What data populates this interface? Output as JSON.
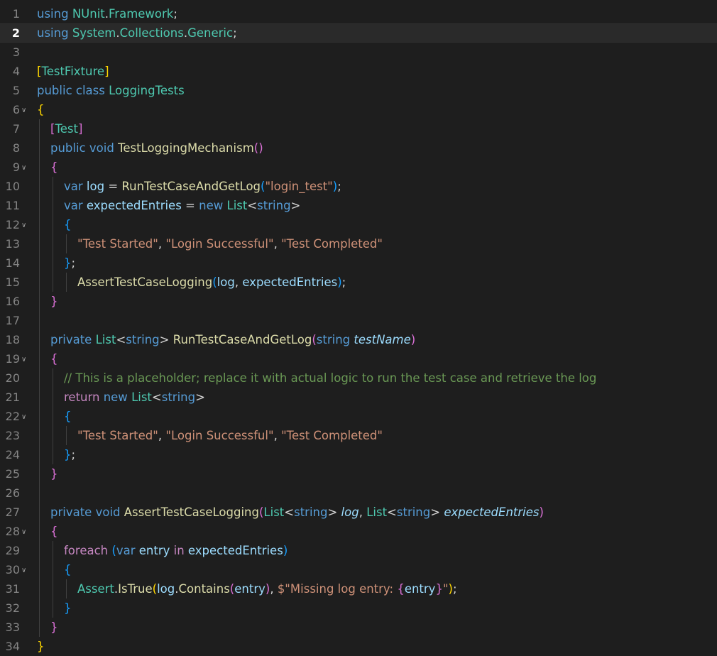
{
  "editor": {
    "current_line": 2,
    "lines": [
      {
        "n": "1",
        "fold": false,
        "indent": 0,
        "tokens": [
          [
            "kw",
            "using"
          ],
          [
            "pu",
            " "
          ],
          [
            "ty",
            "NUnit"
          ],
          [
            "pu",
            "."
          ],
          [
            "ty",
            "Framework"
          ],
          [
            "pu",
            ";"
          ]
        ]
      },
      {
        "n": "2",
        "fold": false,
        "indent": 0,
        "tokens": [
          [
            "kw",
            "using"
          ],
          [
            "pu",
            " "
          ],
          [
            "ty",
            "System"
          ],
          [
            "pu",
            "."
          ],
          [
            "ty",
            "Collections"
          ],
          [
            "pu",
            "."
          ],
          [
            "ty",
            "Generic"
          ],
          [
            "pu",
            ";"
          ]
        ]
      },
      {
        "n": "3",
        "fold": false,
        "indent": 0,
        "tokens": []
      },
      {
        "n": "4",
        "fold": false,
        "indent": 0,
        "tokens": [
          [
            "b1",
            "["
          ],
          [
            "ty",
            "TestFixture"
          ],
          [
            "b1",
            "]"
          ]
        ]
      },
      {
        "n": "5",
        "fold": false,
        "indent": 0,
        "tokens": [
          [
            "kw",
            "public"
          ],
          [
            "pu",
            " "
          ],
          [
            "kw",
            "class"
          ],
          [
            "pu",
            " "
          ],
          [
            "ty",
            "LoggingTests"
          ]
        ]
      },
      {
        "n": "6",
        "fold": true,
        "indent": 0,
        "tokens": [
          [
            "b1",
            "{"
          ]
        ]
      },
      {
        "n": "7",
        "fold": false,
        "indent": 1,
        "tokens": [
          [
            "b2",
            "["
          ],
          [
            "ty",
            "Test"
          ],
          [
            "b2",
            "]"
          ]
        ]
      },
      {
        "n": "8",
        "fold": false,
        "indent": 1,
        "tokens": [
          [
            "kw",
            "public"
          ],
          [
            "pu",
            " "
          ],
          [
            "kw",
            "void"
          ],
          [
            "pu",
            " "
          ],
          [
            "fn",
            "TestLoggingMechanism"
          ],
          [
            "b2",
            "()"
          ]
        ]
      },
      {
        "n": "9",
        "fold": true,
        "indent": 1,
        "tokens": [
          [
            "b2",
            "{"
          ]
        ]
      },
      {
        "n": "10",
        "fold": false,
        "indent": 2,
        "tokens": [
          [
            "kw",
            "var"
          ],
          [
            "pu",
            " "
          ],
          [
            "vr",
            "log"
          ],
          [
            "pu",
            " = "
          ],
          [
            "fn",
            "RunTestCaseAndGetLog"
          ],
          [
            "b3",
            "("
          ],
          [
            "st",
            "\"login_test\""
          ],
          [
            "b3",
            ")"
          ],
          [
            "pu",
            ";"
          ]
        ]
      },
      {
        "n": "11",
        "fold": false,
        "indent": 2,
        "tokens": [
          [
            "kw",
            "var"
          ],
          [
            "pu",
            " "
          ],
          [
            "vr",
            "expectedEntries"
          ],
          [
            "pu",
            " = "
          ],
          [
            "kw",
            "new"
          ],
          [
            "pu",
            " "
          ],
          [
            "ty",
            "List"
          ],
          [
            "pu",
            "<"
          ],
          [
            "kw",
            "string"
          ],
          [
            "pu",
            ">"
          ]
        ]
      },
      {
        "n": "12",
        "fold": true,
        "indent": 2,
        "tokens": [
          [
            "b3",
            "{"
          ]
        ]
      },
      {
        "n": "13",
        "fold": false,
        "indent": 3,
        "tokens": [
          [
            "st",
            "\"Test Started\""
          ],
          [
            "pu",
            ", "
          ],
          [
            "st",
            "\"Login Successful\""
          ],
          [
            "pu",
            ", "
          ],
          [
            "st",
            "\"Test Completed\""
          ]
        ]
      },
      {
        "n": "14",
        "fold": false,
        "indent": 2,
        "tokens": [
          [
            "b3",
            "}"
          ],
          [
            "pu",
            ";"
          ]
        ]
      },
      {
        "n": "15",
        "fold": false,
        "indent": 3,
        "tokens": [
          [
            "fn",
            "AssertTestCaseLogging"
          ],
          [
            "b3",
            "("
          ],
          [
            "vr",
            "log"
          ],
          [
            "pu",
            ", "
          ],
          [
            "vr",
            "expectedEntries"
          ],
          [
            "b3",
            ")"
          ],
          [
            "pu",
            ";"
          ]
        ]
      },
      {
        "n": "16",
        "fold": false,
        "indent": 1,
        "tokens": [
          [
            "b2",
            "}"
          ]
        ]
      },
      {
        "n": "17",
        "fold": false,
        "indent": 0,
        "tokens": []
      },
      {
        "n": "18",
        "fold": false,
        "indent": 1,
        "tokens": [
          [
            "kw",
            "private"
          ],
          [
            "pu",
            " "
          ],
          [
            "ty",
            "List"
          ],
          [
            "pu",
            "<"
          ],
          [
            "kw",
            "string"
          ],
          [
            "pu",
            "> "
          ],
          [
            "fn",
            "RunTestCaseAndGetLog"
          ],
          [
            "b2",
            "("
          ],
          [
            "kw",
            "string"
          ],
          [
            "pu",
            " "
          ],
          [
            "pm",
            "testName"
          ],
          [
            "b2",
            ")"
          ]
        ]
      },
      {
        "n": "19",
        "fold": true,
        "indent": 1,
        "tokens": [
          [
            "b2",
            "{"
          ]
        ]
      },
      {
        "n": "20",
        "fold": false,
        "indent": 2,
        "tokens": [
          [
            "cm",
            "// This is a placeholder; replace it with actual logic to run the test case and retrieve the log"
          ]
        ]
      },
      {
        "n": "21",
        "fold": false,
        "indent": 2,
        "tokens": [
          [
            "ctl",
            "return"
          ],
          [
            "pu",
            " "
          ],
          [
            "kw",
            "new"
          ],
          [
            "pu",
            " "
          ],
          [
            "ty",
            "List"
          ],
          [
            "pu",
            "<"
          ],
          [
            "kw",
            "string"
          ],
          [
            "pu",
            ">"
          ]
        ]
      },
      {
        "n": "22",
        "fold": true,
        "indent": 2,
        "tokens": [
          [
            "b3",
            "{"
          ]
        ]
      },
      {
        "n": "23",
        "fold": false,
        "indent": 3,
        "tokens": [
          [
            "st",
            "\"Test Started\""
          ],
          [
            "pu",
            ", "
          ],
          [
            "st",
            "\"Login Successful\""
          ],
          [
            "pu",
            ", "
          ],
          [
            "st",
            "\"Test Completed\""
          ]
        ]
      },
      {
        "n": "24",
        "fold": false,
        "indent": 2,
        "tokens": [
          [
            "b3",
            "}"
          ],
          [
            "pu",
            ";"
          ]
        ]
      },
      {
        "n": "25",
        "fold": false,
        "indent": 1,
        "tokens": [
          [
            "b2",
            "}"
          ]
        ]
      },
      {
        "n": "26",
        "fold": false,
        "indent": 0,
        "tokens": []
      },
      {
        "n": "27",
        "fold": false,
        "indent": 1,
        "tokens": [
          [
            "kw",
            "private"
          ],
          [
            "pu",
            " "
          ],
          [
            "kw",
            "void"
          ],
          [
            "pu",
            " "
          ],
          [
            "fn",
            "AssertTestCaseLogging"
          ],
          [
            "b2",
            "("
          ],
          [
            "ty",
            "List"
          ],
          [
            "pu",
            "<"
          ],
          [
            "kw",
            "string"
          ],
          [
            "pu",
            "> "
          ],
          [
            "pm",
            "log"
          ],
          [
            "pu",
            ", "
          ],
          [
            "ty",
            "List"
          ],
          [
            "pu",
            "<"
          ],
          [
            "kw",
            "string"
          ],
          [
            "pu",
            "> "
          ],
          [
            "pm",
            "expectedEntries"
          ],
          [
            "b2",
            ")"
          ]
        ]
      },
      {
        "n": "28",
        "fold": true,
        "indent": 1,
        "tokens": [
          [
            "b2",
            "{"
          ]
        ]
      },
      {
        "n": "29",
        "fold": false,
        "indent": 2,
        "tokens": [
          [
            "ctl",
            "foreach"
          ],
          [
            "pu",
            " "
          ],
          [
            "b3",
            "("
          ],
          [
            "kw",
            "var"
          ],
          [
            "pu",
            " "
          ],
          [
            "vr",
            "entry"
          ],
          [
            "pu",
            " "
          ],
          [
            "ctl",
            "in"
          ],
          [
            "pu",
            " "
          ],
          [
            "vr",
            "expectedEntries"
          ],
          [
            "b3",
            ")"
          ]
        ]
      },
      {
        "n": "30",
        "fold": true,
        "indent": 2,
        "tokens": [
          [
            "b3",
            "{"
          ]
        ]
      },
      {
        "n": "31",
        "fold": false,
        "indent": 3,
        "tokens": [
          [
            "ty",
            "Assert"
          ],
          [
            "pu",
            "."
          ],
          [
            "fn",
            "IsTrue"
          ],
          [
            "b1",
            "("
          ],
          [
            "vr",
            "log"
          ],
          [
            "pu",
            "."
          ],
          [
            "fn",
            "Contains"
          ],
          [
            "b2",
            "("
          ],
          [
            "vr",
            "entry"
          ],
          [
            "b2",
            ")"
          ],
          [
            "pu",
            ", "
          ],
          [
            "st",
            "$\"Missing log entry: "
          ],
          [
            "b2",
            "{"
          ],
          [
            "vr",
            "entry"
          ],
          [
            "b2",
            "}"
          ],
          [
            "st",
            "\""
          ],
          [
            "b1",
            ")"
          ],
          [
            "pu",
            ";"
          ]
        ]
      },
      {
        "n": "32",
        "fold": false,
        "indent": 2,
        "tokens": [
          [
            "b3",
            "}"
          ]
        ]
      },
      {
        "n": "33",
        "fold": false,
        "indent": 1,
        "tokens": [
          [
            "b2",
            "}"
          ]
        ]
      },
      {
        "n": "34",
        "fold": false,
        "indent": 0,
        "tokens": [
          [
            "b1",
            "}"
          ]
        ]
      }
    ]
  },
  "colors": {
    "background": "#1e1e1e",
    "current_line": "#2a2a2a",
    "keyword": "#569cd6",
    "type": "#4ec9b0",
    "function": "#dcdcaa",
    "variable": "#9cdcfe",
    "string": "#ce9178",
    "comment": "#6a9955",
    "bracket_1": "#ffd700",
    "bracket_2": "#da70d6",
    "bracket_3": "#179fff"
  },
  "icons": {
    "fold": "chevron-down-icon"
  }
}
